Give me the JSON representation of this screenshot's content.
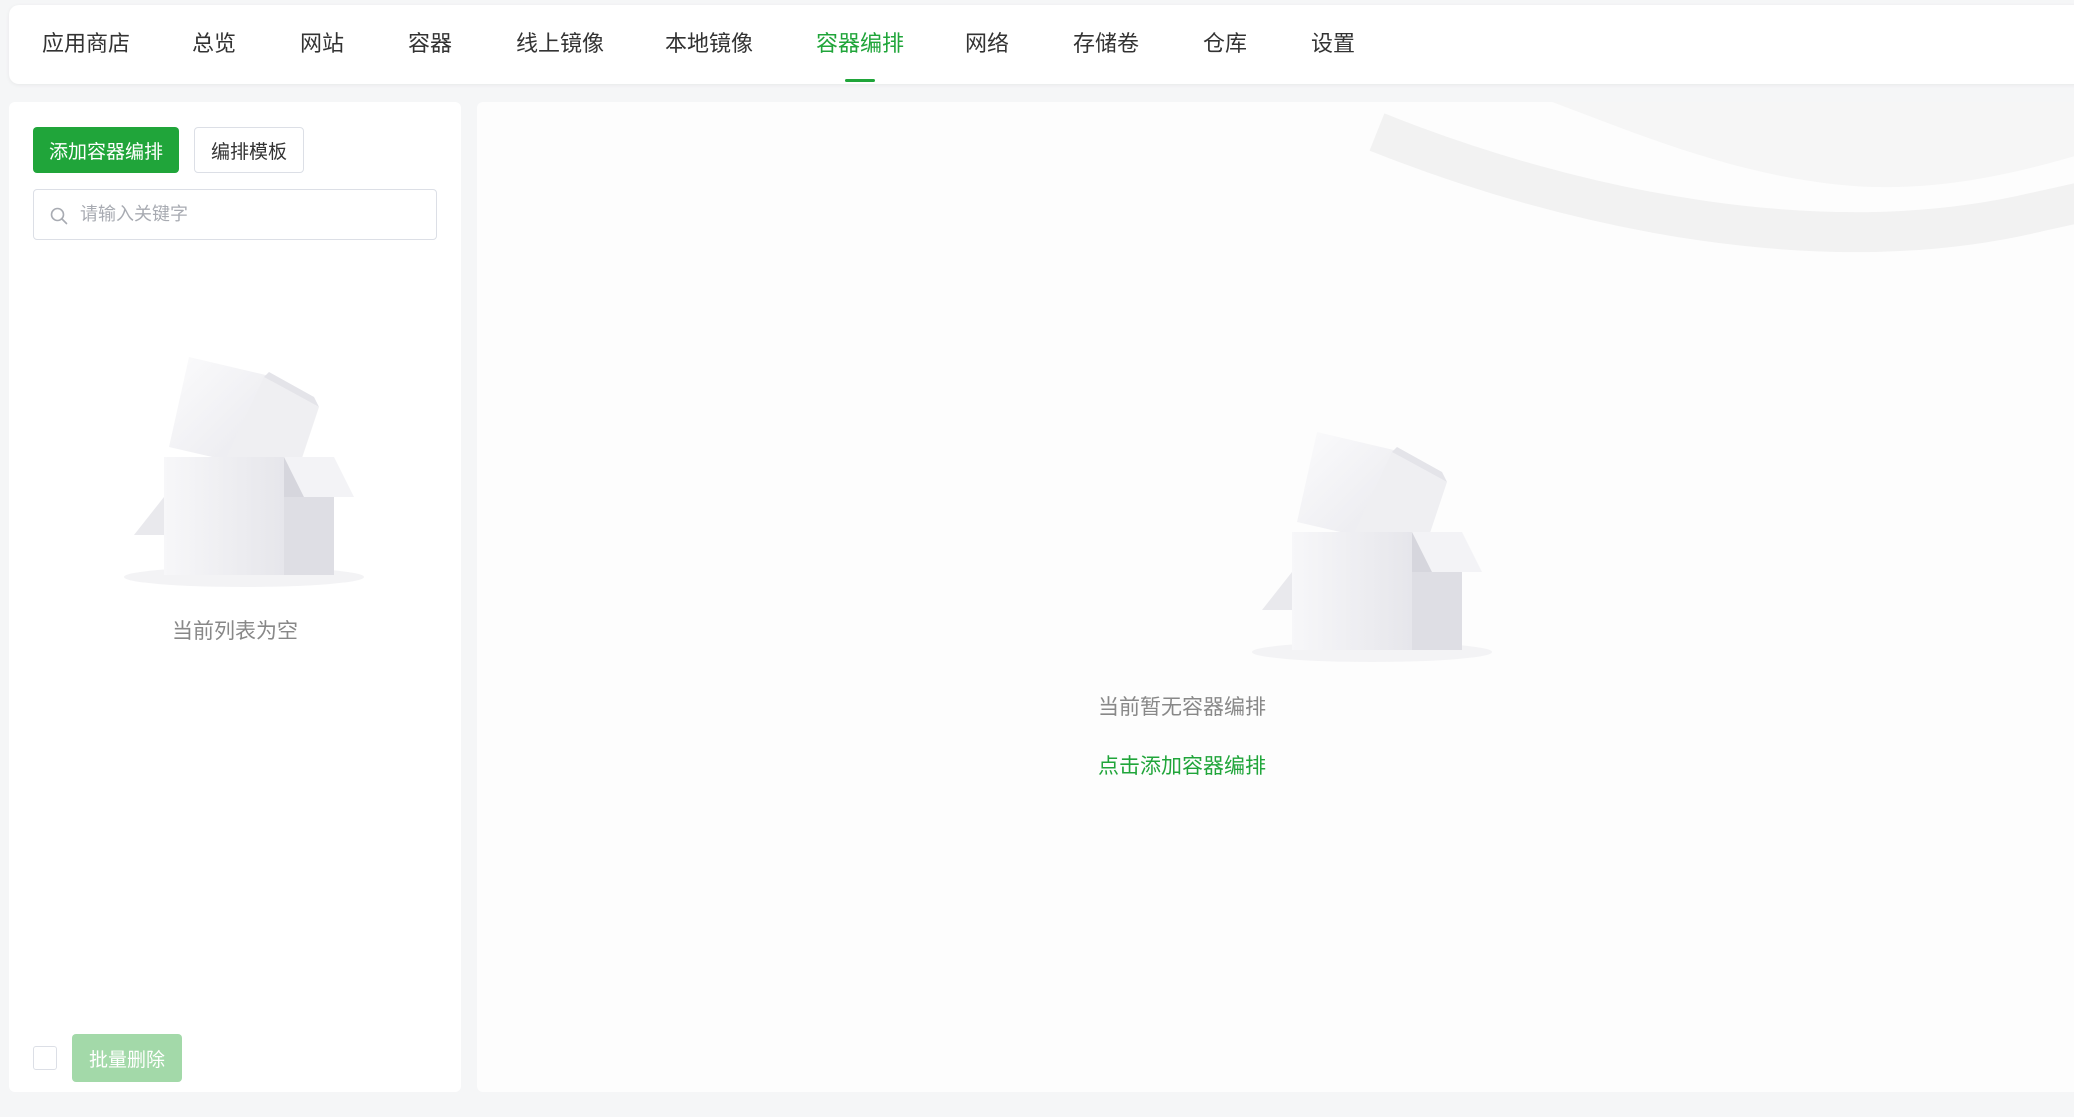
{
  "nav": {
    "tabs": [
      {
        "label": "应用商店"
      },
      {
        "label": "总览"
      },
      {
        "label": "网站"
      },
      {
        "label": "容器"
      },
      {
        "label": "线上镜像"
      },
      {
        "label": "本地镜像"
      },
      {
        "label": "容器编排",
        "active": true
      },
      {
        "label": "网络"
      },
      {
        "label": "存储卷"
      },
      {
        "label": "仓库"
      },
      {
        "label": "设置"
      }
    ]
  },
  "sidebar": {
    "add_button": "添加容器编排",
    "template_button": "编排模板",
    "search_placeholder": "请输入关键字",
    "empty_text": "当前列表为空",
    "batch_delete_button": "批量删除"
  },
  "main": {
    "empty_text": "当前暂无容器编排",
    "add_link": "点击添加容器编排"
  },
  "colors": {
    "accent": "#20a53a",
    "accent_disabled": "#a3d9a9",
    "text": "#333333",
    "muted": "#888888"
  },
  "icons": {
    "search": "search-icon",
    "empty": "empty-box-icon"
  }
}
